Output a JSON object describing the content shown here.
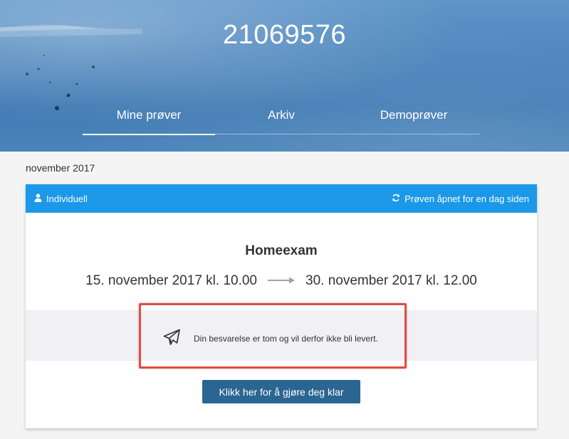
{
  "header": {
    "title": "21069576",
    "tabs": [
      {
        "label": "Mine prøver",
        "active": true
      },
      {
        "label": "Arkiv",
        "active": false
      },
      {
        "label": "Demoprøver",
        "active": false
      }
    ]
  },
  "section": {
    "month": "november 2017"
  },
  "card": {
    "type_label": "Individuell",
    "status_label": "Prøven åpnet for en dag siden",
    "exam_title": "Homeexam",
    "start": "15. november 2017 kl. 10.00",
    "end": "30. november 2017 kl. 12.00",
    "message": "Din besvarelse er tom og vil derfor ikke bli levert.",
    "button_label": "Klikk her for å gjøre deg klar"
  },
  "colors": {
    "header_blue": "#1b98e8",
    "button_blue": "#2b6591",
    "highlight_red": "#e24b45"
  },
  "icons": {
    "type": "user-icon",
    "status": "refresh-icon",
    "message": "paper-plane-icon",
    "arrow": "arrow-right-icon"
  }
}
